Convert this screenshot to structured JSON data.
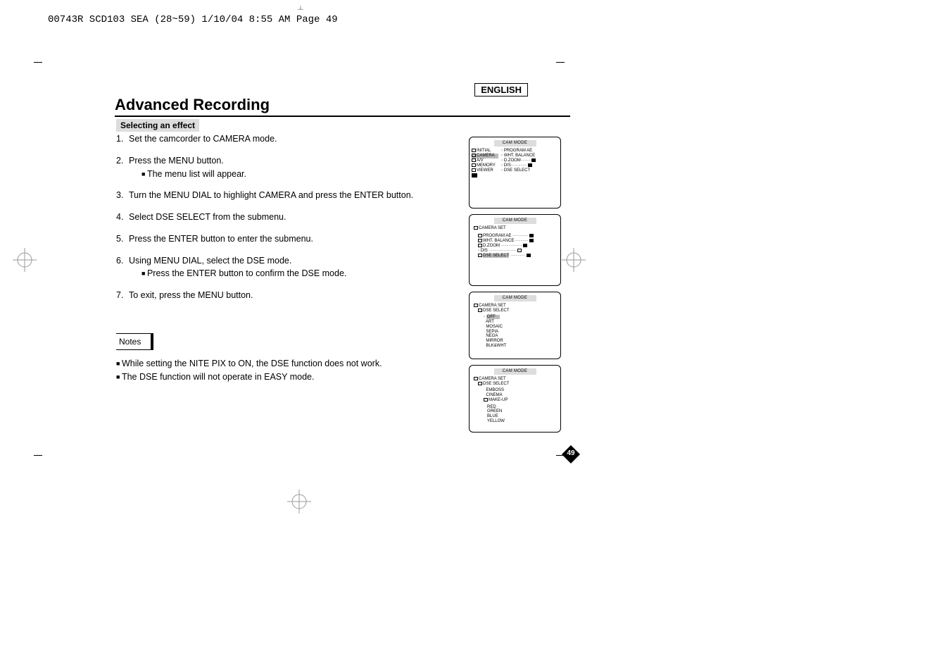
{
  "print_header": "00743R SCD103 SEA (28~59)  1/10/04 8:55 AM  Page 49",
  "lang": "ENGLISH",
  "title": "Advanced Recording",
  "section": "Selecting an effect",
  "steps": [
    {
      "num": "1.",
      "text": "Set the camcorder to CAMERA mode."
    },
    {
      "num": "2.",
      "text": "Press the MENU button.",
      "sub": [
        "The menu list will appear."
      ]
    },
    {
      "num": "3.",
      "text": "Turn the MENU DIAL to highlight CAMERA and press the ENTER button."
    },
    {
      "num": "4.",
      "text": "Select DSE SELECT from the submenu."
    },
    {
      "num": "5.",
      "text": "Press the ENTER button to enter the submenu."
    },
    {
      "num": "6.",
      "text": "Using MENU DIAL, select the DSE mode.",
      "sub": [
        "Press the ENTER button to confirm the DSE mode."
      ]
    },
    {
      "num": "7.",
      "text": "To exit, press the MENU button."
    }
  ],
  "notes_label": "Notes",
  "notes": [
    "While setting the NITE PIX to ON, the DSE function does not work.",
    "The DSE function will not operate in EASY mode."
  ],
  "page_number": "49",
  "screens": {
    "cam_mode": "CAM MODE",
    "s1": {
      "left": [
        "INITIAL",
        "CAMERA",
        "A/V",
        "MEMORY",
        "VIEWER"
      ],
      "right_prefix": "◦",
      "right": [
        "PROGRAM AE",
        "WHT. BALANCE",
        "D.ZOOM",
        "DIS",
        "DSE SELECT"
      ]
    },
    "s2": {
      "header": "CAMERA SET",
      "items": [
        "PROGRAM AE",
        "WHT. BALANCE",
        "D.ZOOM",
        "DIS",
        "DSE SELECT"
      ]
    },
    "s3": {
      "header1": "CAMERA SET",
      "header2": "DSE SELECT",
      "items": [
        "OFF",
        "ART",
        "MOSAIC",
        "SEPIA",
        "NEGA",
        "MIRROR",
        "BLK&WHT"
      ]
    },
    "s4": {
      "header1": "CAMERA SET",
      "header2": "DSE SELECT",
      "group1": [
        "EMBOSS",
        "CINEMA",
        "MAKE-UP"
      ],
      "group2": [
        "RED",
        "GREEN",
        "BLUE",
        "YELLOW"
      ]
    }
  }
}
